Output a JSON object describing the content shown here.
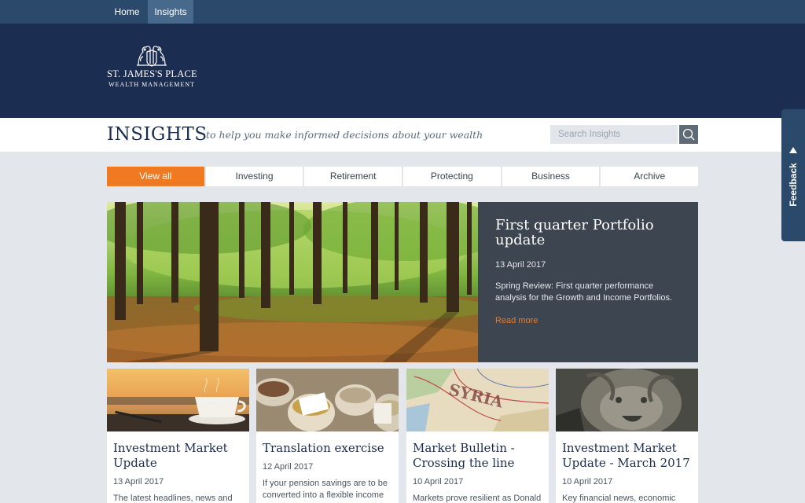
{
  "topnav": {
    "home": "Home",
    "insights": "Insights"
  },
  "brand": {
    "line1": "ST. JAMES'S PLACE",
    "line2": "WEALTH MANAGEMENT",
    "logo_icon": "lion-unicorn-crest-icon"
  },
  "header": {
    "title": "INSIGHTS",
    "tagline": "to help you make informed decisions about your wealth",
    "search_placeholder": "Search Insights",
    "search_icon": "search-icon"
  },
  "tabs": [
    {
      "label": "View all",
      "active": true
    },
    {
      "label": "Investing"
    },
    {
      "label": "Retirement"
    },
    {
      "label": "Protecting"
    },
    {
      "label": "Business"
    },
    {
      "label": "Archive"
    }
  ],
  "featured": {
    "title": "First quarter Portfolio update",
    "date": "13 April 2017",
    "description": "Spring Review: First quarter performance analysis for the Growth and Income Portfolios.",
    "link": "Read more"
  },
  "cards": [
    {
      "title": "Investment Market Update",
      "date": "13 April 2017",
      "description": "The latest headlines, news and",
      "image": "coffee-cup-photo"
    },
    {
      "title": "Translation exercise",
      "date": "12 April 2017",
      "description": "If your pension savings are to be converted into a flexible income",
      "image": "market-spice-sacks-photo"
    },
    {
      "title": "Market Bulletin - Crossing the line",
      "date": "10 April 2017",
      "description": "Markets prove resilient as Donald",
      "image": "syria-map-photo"
    },
    {
      "title": "Investment Market Update - March 2017",
      "date": "10 April 2017",
      "description": "Key financial news, economic",
      "image": "stone-lion-statue-photo"
    }
  ],
  "feedback": {
    "label": "Feedback"
  },
  "colors": {
    "accent": "#ef7a22",
    "navy": "#1c2d52",
    "topnav": "#2b4a6b",
    "panel": "#3c4550",
    "background": "#e3e7ec"
  }
}
